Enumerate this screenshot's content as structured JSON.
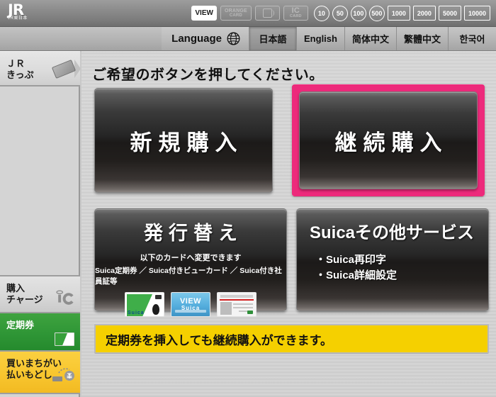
{
  "topbar": {
    "logo_main": "JR",
    "logo_sub": "JR東日本",
    "cards": [
      {
        "name": "view-card",
        "line1": "VIEW",
        "line2": "",
        "state": "on"
      },
      {
        "name": "orange-card",
        "line1": "ORANGE",
        "line2": "CARD",
        "state": "off"
      },
      {
        "name": "id-card",
        "line1": "",
        "line2": "",
        "state": "off"
      },
      {
        "name": "ic-card",
        "line1": "IC",
        "line2": "CARD",
        "state": "off"
      }
    ],
    "coins": [
      "10",
      "50",
      "100",
      "500"
    ],
    "bills": [
      "1000",
      "2000",
      "5000",
      "10000"
    ]
  },
  "language": {
    "label": "Language",
    "options": [
      {
        "label": "日本語",
        "active": true
      },
      {
        "label": "English",
        "active": false
      },
      {
        "label": "简体中文",
        "active": false
      },
      {
        "label": "繁體中文",
        "active": false
      },
      {
        "label": "한국어",
        "active": false
      }
    ]
  },
  "sidebar": {
    "items": [
      {
        "label": "ＪＲ\nきっぷ",
        "icon": "ticket-icon",
        "state": "inactive"
      },
      {
        "label": "購入\nチャージ",
        "icon": "ic-logo-icon",
        "state": "inactive"
      },
      {
        "label": "定期券",
        "icon": "commuter-pass-icon",
        "state": "active"
      },
      {
        "label": "買いまちがい\n払いもどし",
        "icon": "refund-icon",
        "state": "inactive"
      }
    ]
  },
  "main": {
    "headline": "ご希望のボタンを押してください。",
    "buttons": {
      "new_purchase": {
        "title": "新規購入"
      },
      "renewal_purchase": {
        "title": "継続購入",
        "highlighted": true
      },
      "reissue": {
        "title": "発行替え",
        "sub1": "以下のカードへ変更できます",
        "sub2": "Suica定期券 ／ Suica付きビューカード ／ Suica付き社員証等",
        "cards": [
          {
            "name": "suica-card",
            "label": "Suica"
          },
          {
            "name": "view-suica-card",
            "label_top": "VIEW",
            "label_bottom": "Suica"
          },
          {
            "name": "employee-id-card",
            "label": ""
          }
        ]
      },
      "suica_services": {
        "title": "Suicaその他サービス",
        "bullets": [
          "・Suica再印字",
          "・Suica詳細設定"
        ]
      }
    },
    "notice": "定期券を挿入しても継続購入ができます。"
  },
  "colors": {
    "highlight_pink": "#ed2a7b",
    "notice_yellow": "#f5d000",
    "active_green": "#2f9636",
    "refund_yellow": "#f8c62f"
  }
}
